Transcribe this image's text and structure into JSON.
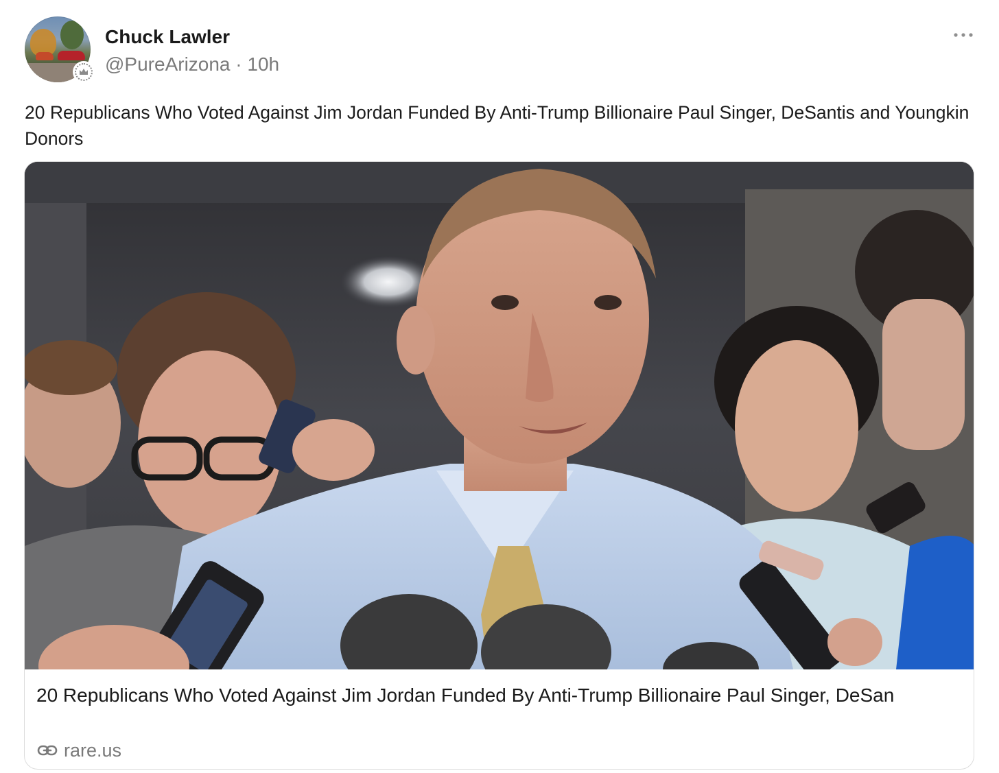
{
  "author": {
    "name": "Chuck Lawler",
    "handle": "@PureArizona",
    "separator": "·",
    "time": "10h"
  },
  "post": {
    "text": "20 Republicans Who Voted Against Jim Jordan Funded By Anti-Trump Billionaire Paul Singer, DeSantis and Youngkin Donors"
  },
  "link_card": {
    "title": "20 Republicans Who Voted Against Jim Jordan Funded By Anti-Trump Billionaire Paul Singer, DeSan",
    "domain": "rare.us"
  },
  "icons": {
    "more": "more-horizontal-icon",
    "link": "link-icon",
    "badge": "crown-badge-icon"
  },
  "colors": {
    "text_primary": "#1a1a1a",
    "text_secondary": "#7a7a7a",
    "card_border": "#dcdcdc",
    "shirt": "#bcd0ea",
    "tie": "#c9ad6a"
  }
}
